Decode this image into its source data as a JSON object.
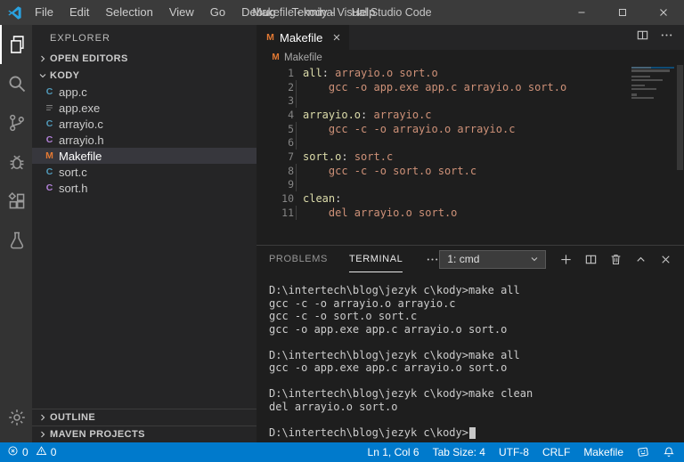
{
  "window": {
    "title": "Makefile - kody - Visual Studio Code"
  },
  "titlebar": {
    "menus": [
      "File",
      "Edit",
      "Selection",
      "View",
      "Go",
      "Debug",
      "Terminal",
      "Help"
    ],
    "controls": [
      {
        "name": "minimize",
        "icon": "minimize-icon"
      },
      {
        "name": "maximize",
        "icon": "maximize-icon"
      },
      {
        "name": "close-window",
        "icon": "close-icon"
      }
    ]
  },
  "activitybar": {
    "top": [
      {
        "name": "explorer",
        "icon": "files-icon",
        "active": true
      },
      {
        "name": "search",
        "icon": "search-icon",
        "active": false
      },
      {
        "name": "source-control",
        "icon": "source-control-icon",
        "active": false
      },
      {
        "name": "debug",
        "icon": "debug-icon",
        "active": false
      },
      {
        "name": "extensions",
        "icon": "extensions-icon",
        "active": false
      },
      {
        "name": "test",
        "icon": "test-flask-icon",
        "active": false
      }
    ],
    "bottom": [
      {
        "name": "manage",
        "icon": "gear-icon",
        "active": false
      }
    ]
  },
  "sidebar": {
    "title": "EXPLORER",
    "open_editors_label": "OPEN EDITORS",
    "folder_label": "KODY",
    "files": [
      {
        "name": "app.c",
        "icon": "c-blue-icon",
        "selected": false
      },
      {
        "name": "app.exe",
        "icon": "exe-icon",
        "selected": false
      },
      {
        "name": "arrayio.c",
        "icon": "c-blue-icon",
        "selected": false
      },
      {
        "name": "arrayio.h",
        "icon": "c-purple-icon",
        "selected": false
      },
      {
        "name": "Makefile",
        "icon": "makefile-icon",
        "selected": true
      },
      {
        "name": "sort.c",
        "icon": "c-blue-icon",
        "selected": false
      },
      {
        "name": "sort.h",
        "icon": "c-purple-icon",
        "selected": false
      }
    ],
    "bottom_sections": [
      {
        "label": "OUTLINE"
      },
      {
        "label": "MAVEN PROJECTS"
      }
    ]
  },
  "editor": {
    "tab": {
      "label": "Makefile",
      "icon": "makefile-icon"
    },
    "breadcrumb": {
      "label": "Makefile",
      "icon": "makefile-icon"
    },
    "code_lines": [
      {
        "num": "1",
        "guide": false,
        "parts": [
          {
            "text": "all",
            "style": "target"
          },
          {
            "text": ":",
            "style": "plain"
          },
          {
            "text": " arrayio.o sort.o",
            "style": "value"
          }
        ]
      },
      {
        "num": "2",
        "guide": true,
        "parts": [
          {
            "text": "    gcc -o app.exe app.c arrayio.o sort.o",
            "style": "value"
          }
        ]
      },
      {
        "num": "3",
        "guide": true,
        "parts": []
      },
      {
        "num": "4",
        "guide": false,
        "parts": [
          {
            "text": "arrayio.o",
            "style": "target"
          },
          {
            "text": ":",
            "style": "plain"
          },
          {
            "text": " arrayio.c",
            "style": "value"
          }
        ]
      },
      {
        "num": "5",
        "guide": true,
        "parts": [
          {
            "text": "    gcc -c -o arrayio.o arrayio.c",
            "style": "value"
          }
        ]
      },
      {
        "num": "6",
        "guide": true,
        "parts": []
      },
      {
        "num": "7",
        "guide": false,
        "parts": [
          {
            "text": "sort.o",
            "style": "target"
          },
          {
            "text": ":",
            "style": "plain"
          },
          {
            "text": " sort.c",
            "style": "value"
          }
        ]
      },
      {
        "num": "8",
        "guide": true,
        "parts": [
          {
            "text": "    gcc -c -o sort.o sort.c",
            "style": "value"
          }
        ]
      },
      {
        "num": "9",
        "guide": true,
        "parts": []
      },
      {
        "num": "10",
        "guide": false,
        "parts": [
          {
            "text": "clean",
            "style": "target"
          },
          {
            "text": ":",
            "style": "plain"
          }
        ]
      },
      {
        "num": "11",
        "guide": true,
        "parts": [
          {
            "text": "    del arrayio.o sort.o",
            "style": "value"
          }
        ]
      }
    ]
  },
  "panel": {
    "tabs": [
      {
        "label": "PROBLEMS",
        "active": false
      },
      {
        "label": "TERMINAL",
        "active": true
      }
    ],
    "dropdown": {
      "value": "1: cmd"
    },
    "actions": [
      {
        "name": "new-terminal",
        "icon": "plus-icon"
      },
      {
        "name": "split-terminal",
        "icon": "split-icon"
      },
      {
        "name": "kill-terminal",
        "icon": "trash-icon"
      },
      {
        "name": "maximize-panel",
        "icon": "chevron-up-icon"
      },
      {
        "name": "close-panel",
        "icon": "close-icon"
      }
    ]
  },
  "terminal": {
    "lines": [
      "D:\\intertech\\blog\\jezyk c\\kody>make all",
      "gcc -c -o arrayio.o arrayio.c",
      "gcc -c -o sort.o sort.c",
      "gcc -o app.exe app.c arrayio.o sort.o",
      "",
      "D:\\intertech\\blog\\jezyk c\\kody>make all",
      "gcc -o app.exe app.c arrayio.o sort.o",
      "",
      "D:\\intertech\\blog\\jezyk c\\kody>make clean",
      "del arrayio.o sort.o",
      "",
      "D:\\intertech\\blog\\jezyk c\\kody>"
    ],
    "cursor_on_last_line": true
  },
  "statusbar": {
    "errors": "0",
    "warnings": "0",
    "right": [
      {
        "name": "cursor-position",
        "label": "Ln 1, Col 6"
      },
      {
        "name": "tab-size",
        "label": "Tab Size: 4"
      },
      {
        "name": "encoding",
        "label": "UTF-8"
      },
      {
        "name": "eol",
        "label": "CRLF"
      },
      {
        "name": "language-mode",
        "label": "Makefile"
      },
      {
        "name": "feedback",
        "icon": "feedback-icon"
      },
      {
        "name": "notifications",
        "icon": "bell-icon"
      }
    ]
  },
  "colors": {
    "accent": "#007acc",
    "titlebar": "#3b3b3b",
    "activitybar": "#333333",
    "sidebar": "#252526",
    "editor": "#1e1e1e",
    "selection": "#37373d",
    "token_target": "#dcdcaa",
    "token_value": "#ce9178",
    "makefile_icon": "#e37933",
    "c_icon_blue": "#519aba",
    "h_icon_purple": "#b180d7"
  }
}
